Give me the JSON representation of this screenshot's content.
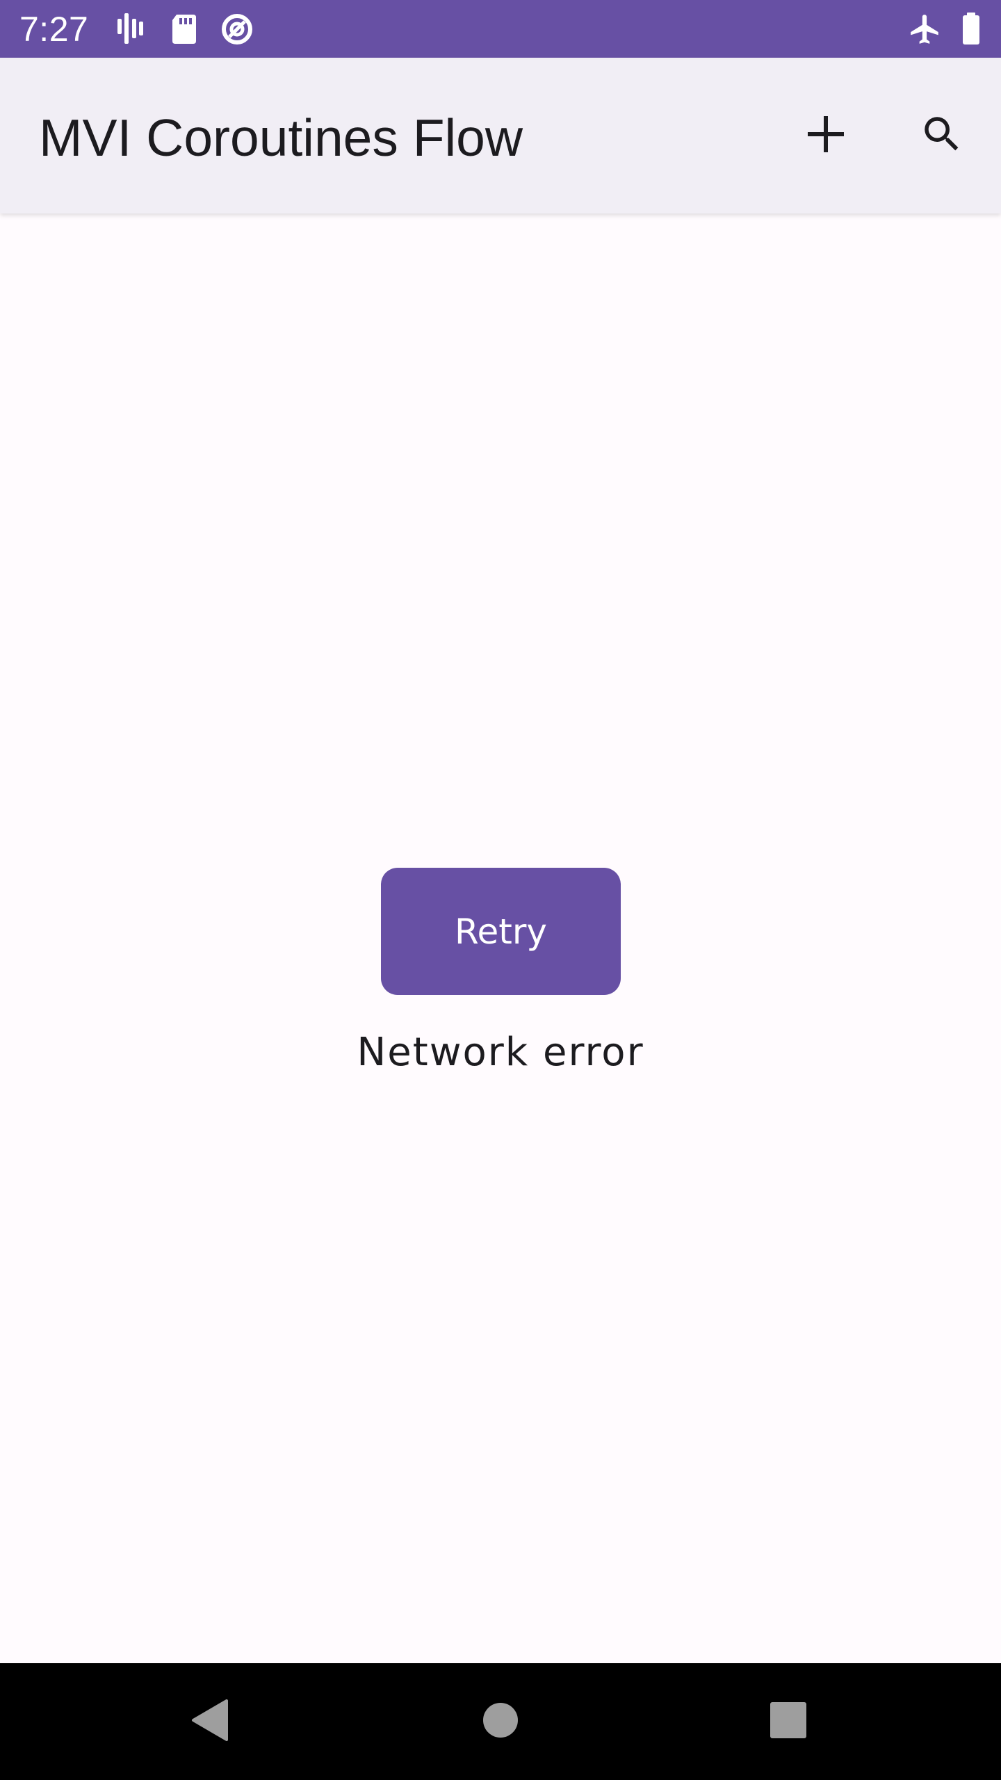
{
  "status_bar": {
    "time": "7:27",
    "icons": [
      "signal-bars-icon",
      "sd-card-icon",
      "data-saver-icon",
      "airplane-mode-icon",
      "battery-icon"
    ],
    "background_color": "#6750A4"
  },
  "app_bar": {
    "title": "MVI Coroutines Flow",
    "actions": [
      "add-icon",
      "search-icon"
    ],
    "background_color": "#F1EEF5"
  },
  "content": {
    "retry_label": "Retry",
    "error_message": "Network error",
    "accent_color": "#6750A4"
  },
  "nav_bar": {
    "buttons": [
      "back-icon",
      "home-icon",
      "recents-icon"
    ]
  }
}
